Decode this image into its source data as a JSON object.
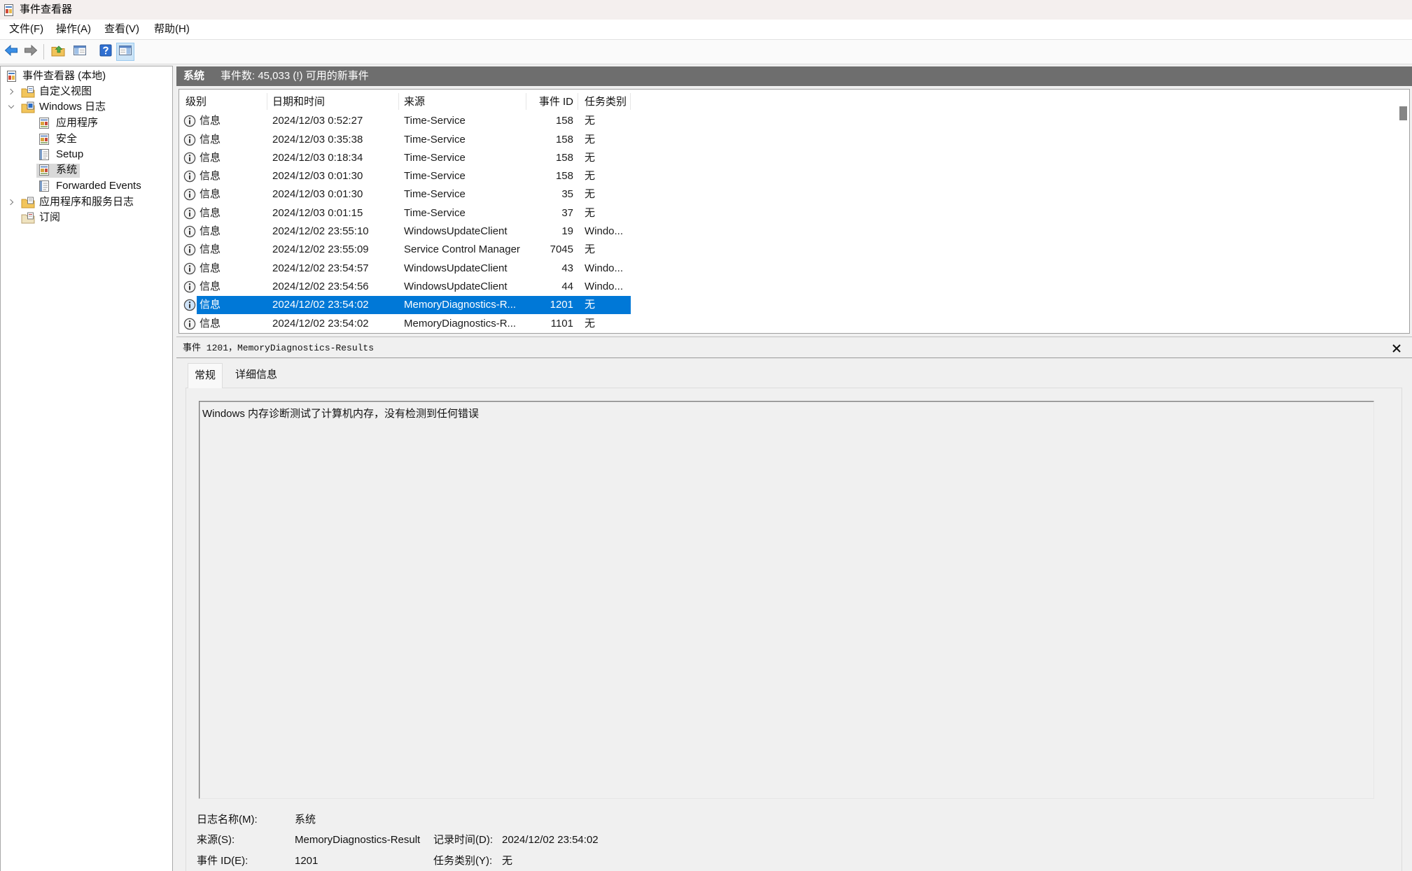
{
  "window": {
    "title": "事件查看器"
  },
  "menu": {
    "file": "文件(F)",
    "action": "操作(A)",
    "view": "查看(V)",
    "help": "帮助(H)"
  },
  "toolbar": {
    "icons": [
      "back-arrow-icon",
      "forward-arrow-icon",
      "up-one-level-icon",
      "show-hide-console-tree-icon",
      "help-icon",
      "show-hide-action-pane-icon"
    ]
  },
  "tree": {
    "root": "事件查看器 (本地)",
    "custom_views": "自定义视图",
    "windows_logs": "Windows 日志",
    "windows_log_items": [
      "应用程序",
      "安全",
      "Setup",
      "系统",
      "Forwarded Events"
    ],
    "selected_index": 3,
    "app_service_logs": "应用程序和服务日志",
    "subscriptions": "订阅"
  },
  "log_header": {
    "name": "系统",
    "summary": "事件数: 45,033 (!) 可用的新事件"
  },
  "event_list": {
    "columns": {
      "level": "级别",
      "datetime": "日期和时间",
      "source": "来源",
      "event_id": "事件 ID",
      "task_category": "任务类别"
    },
    "selected_index": 10,
    "rows": [
      {
        "level": "信息",
        "datetime": "2024/12/03 0:52:27",
        "source": "Time-Service",
        "event_id": "158",
        "task_category": "无"
      },
      {
        "level": "信息",
        "datetime": "2024/12/03 0:35:38",
        "source": "Time-Service",
        "event_id": "158",
        "task_category": "无"
      },
      {
        "level": "信息",
        "datetime": "2024/12/03 0:18:34",
        "source": "Time-Service",
        "event_id": "158",
        "task_category": "无"
      },
      {
        "level": "信息",
        "datetime": "2024/12/03 0:01:30",
        "source": "Time-Service",
        "event_id": "158",
        "task_category": "无"
      },
      {
        "level": "信息",
        "datetime": "2024/12/03 0:01:30",
        "source": "Time-Service",
        "event_id": "35",
        "task_category": "无"
      },
      {
        "level": "信息",
        "datetime": "2024/12/03 0:01:15",
        "source": "Time-Service",
        "event_id": "37",
        "task_category": "无"
      },
      {
        "level": "信息",
        "datetime": "2024/12/02 23:55:10",
        "source": "WindowsUpdateClient",
        "event_id": "19",
        "task_category": "Windo..."
      },
      {
        "level": "信息",
        "datetime": "2024/12/02 23:55:09",
        "source": "Service Control Manager",
        "event_id": "7045",
        "task_category": "无"
      },
      {
        "level": "信息",
        "datetime": "2024/12/02 23:54:57",
        "source": "WindowsUpdateClient",
        "event_id": "43",
        "task_category": "Windo..."
      },
      {
        "level": "信息",
        "datetime": "2024/12/02 23:54:56",
        "source": "WindowsUpdateClient",
        "event_id": "44",
        "task_category": "Windo..."
      },
      {
        "level": "信息",
        "datetime": "2024/12/02 23:54:02",
        "source": "MemoryDiagnostics-R...",
        "event_id": "1201",
        "task_category": "无"
      },
      {
        "level": "信息",
        "datetime": "2024/12/02 23:54:02",
        "source": "MemoryDiagnostics-R...",
        "event_id": "1101",
        "task_category": "无"
      }
    ]
  },
  "detail": {
    "title": "事件 1201，MemoryDiagnostics-Results",
    "tabs": [
      "常规",
      "详细信息"
    ],
    "active_tab_index": 0,
    "description": "Windows 内存诊断测试了计算机内存，没有检测到任何错误",
    "fields": {
      "log_name_label": "日志名称(M):",
      "log_name": "系统",
      "source_label": "来源(S):",
      "source": "MemoryDiagnostics-Result",
      "logged_label": "记录时间(D):",
      "logged": "2024/12/02 23:54:02",
      "event_id_label": "事件 ID(E):",
      "event_id": "1201",
      "task_category_label": "任务类别(Y):",
      "task_category": "无"
    }
  },
  "colors": {
    "selection": "#0078d7",
    "header_bar": "#6e6e6e",
    "tree_selection": "#d9d9d9"
  }
}
